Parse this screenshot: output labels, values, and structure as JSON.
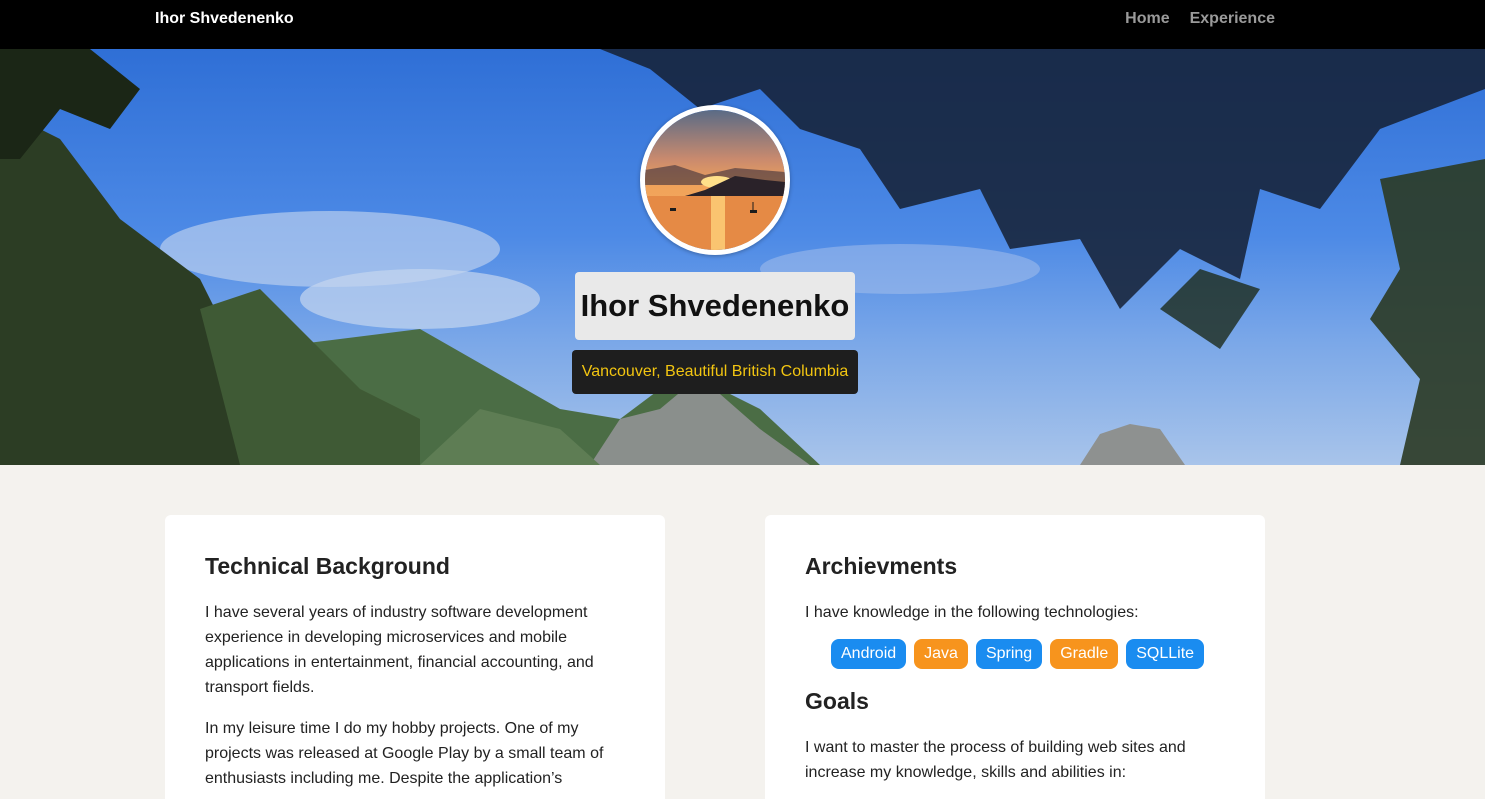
{
  "nav": {
    "brand": "Ihor Shvedenenko",
    "links": [
      "Home",
      "Experience"
    ]
  },
  "hero": {
    "name": "Ihor Shvedenenko",
    "location": "Vancouver, Beautiful British Columbia"
  },
  "technical": {
    "title": "Technical Background",
    "paragraphs": [
      "I have several years of industry software development experience in developing microservices and mobile applications in entertainment, financial accounting, and transport fields.",
      "In my leisure time I do my hobby projects. One of my projects was released at Google Play by a small team of enthusiasts including me. Despite the application’s"
    ]
  },
  "achievements": {
    "title": "Archievments",
    "intro": "I have knowledge in the following technologies:",
    "tags": [
      {
        "label": "Android",
        "color": "#1a8cf0"
      },
      {
        "label": "Java",
        "color": "#f7941d"
      },
      {
        "label": "Spring",
        "color": "#1a8cf0"
      },
      {
        "label": "Gradle",
        "color": "#f7941d"
      },
      {
        "label": "SQLLite",
        "color": "#1a8cf0"
      }
    ]
  },
  "goals": {
    "title": "Goals",
    "text": "I want to master the process of building web sites and increase my knowledge, skills and abilities in:"
  },
  "colors": {
    "nav_bg": "#000000",
    "page_bg": "#f4f2ee",
    "location_text": "#f2c511",
    "tag_blue": "#1a8cf0",
    "tag_orange": "#f7941d"
  }
}
